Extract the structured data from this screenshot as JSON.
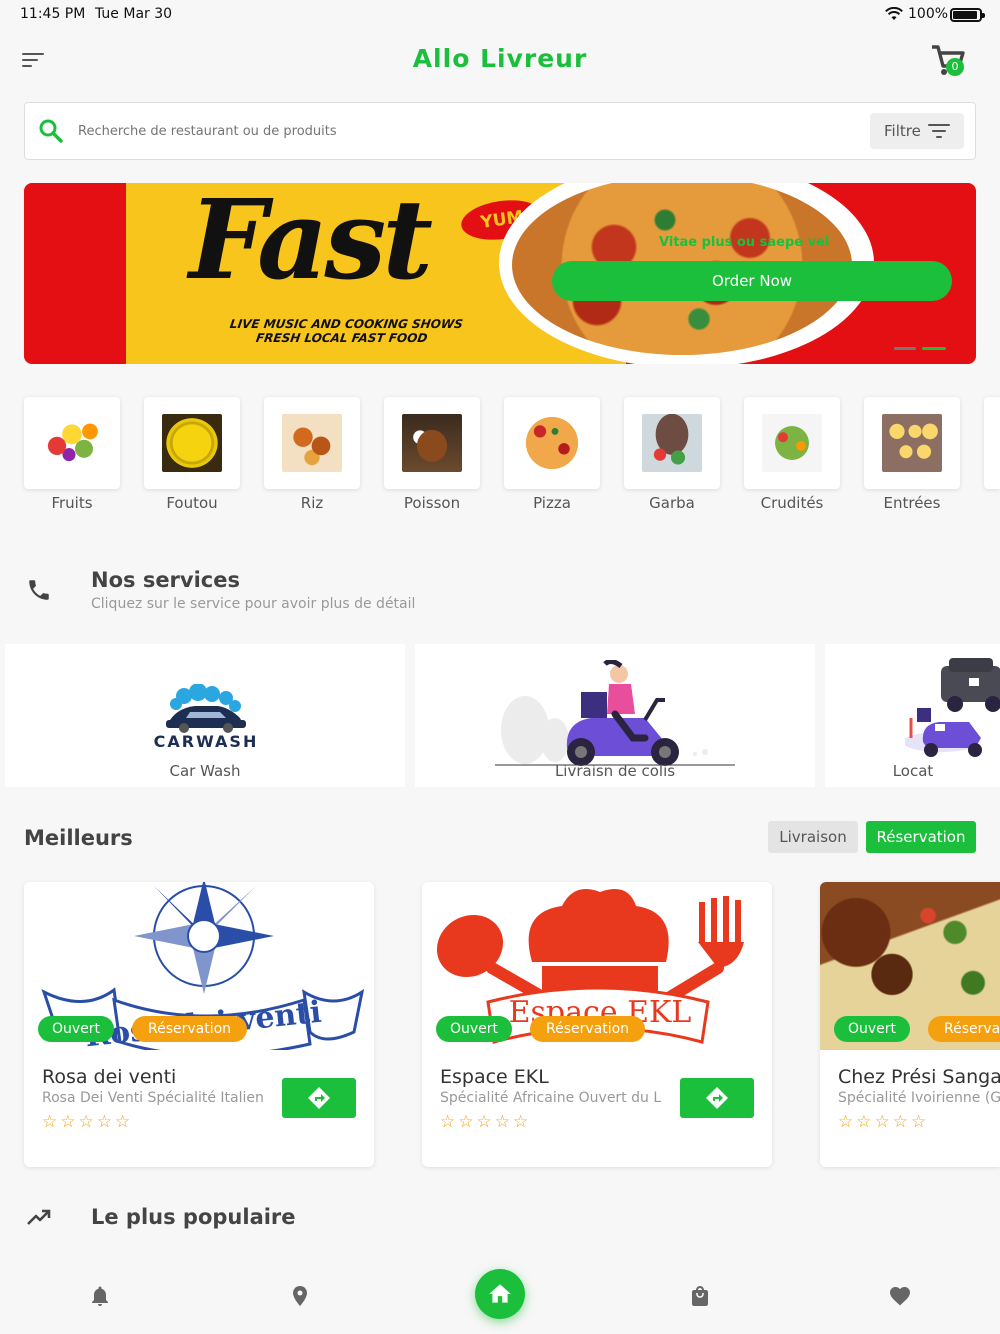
{
  "status_bar": {
    "time": "11:45 PM",
    "date": "Tue Mar 30",
    "battery": "100%"
  },
  "header": {
    "title": "Allo Livreur",
    "cart_count": "0"
  },
  "search": {
    "placeholder": "Recherche de restaurant ou de produits",
    "filter_label": "Filtre"
  },
  "banner": {
    "headline": "Fast",
    "yum": "YUM",
    "tagline_line1": "LIVE MUSIC AND COOKING SHOWS",
    "tagline_line2": "FRESH LOCAL FAST FOOD",
    "slogan": "Vitae plus ou saepe vel",
    "cta": "Order Now",
    "active_slide": 2,
    "slide_count": 2
  },
  "categories": [
    {
      "label": "Fruits",
      "icon": "fruits"
    },
    {
      "label": "Foutou",
      "icon": "foutou"
    },
    {
      "label": "Riz",
      "icon": "riz"
    },
    {
      "label": "Poisson",
      "icon": "poisson"
    },
    {
      "label": "Pizza",
      "icon": "pizza"
    },
    {
      "label": "Garba",
      "icon": "garba"
    },
    {
      "label": "Crudités",
      "icon": "crudites"
    },
    {
      "label": "Entrées",
      "icon": "entrees"
    }
  ],
  "services": {
    "title": "Nos services",
    "subtitle": "Cliquez sur le service pour avoir plus de détail",
    "items": [
      {
        "label": "Car Wash",
        "logo_text": "CARWASH"
      },
      {
        "label": "Livraisn de colis"
      },
      {
        "label": "Locat"
      }
    ]
  },
  "best": {
    "title": "Meilleurs",
    "tabs": {
      "delivery": "Livraison",
      "reservation": "Réservation"
    },
    "active_tab": "reservation",
    "restaurants": [
      {
        "name": "Rosa dei venti",
        "desc": "Rosa Dei Venti Spécialité Italienne",
        "open": "Ouvert",
        "reservation": "Réservation",
        "stars": "☆☆☆☆☆",
        "logo_text": "Rosa dei venti"
      },
      {
        "name": "Espace EKL",
        "desc": "Spécialité Africaine Ouvert du L",
        "open": "Ouvert",
        "reservation": "Réservation",
        "stars": "☆☆☆☆☆",
        "logo_text": "Espace EKL"
      },
      {
        "name": "Chez Prési Sanga",
        "desc": "Spécialité Ivoirienne (G",
        "open": "Ouvert",
        "reservation": "Réserva",
        "stars": "☆☆☆☆☆"
      }
    ]
  },
  "popular": {
    "title": "Le plus populaire"
  },
  "colors": {
    "accent": "#1bbf3c",
    "warning": "#f5a00f",
    "banner_red": "#e30f12",
    "banner_yellow": "#f7c51b"
  }
}
